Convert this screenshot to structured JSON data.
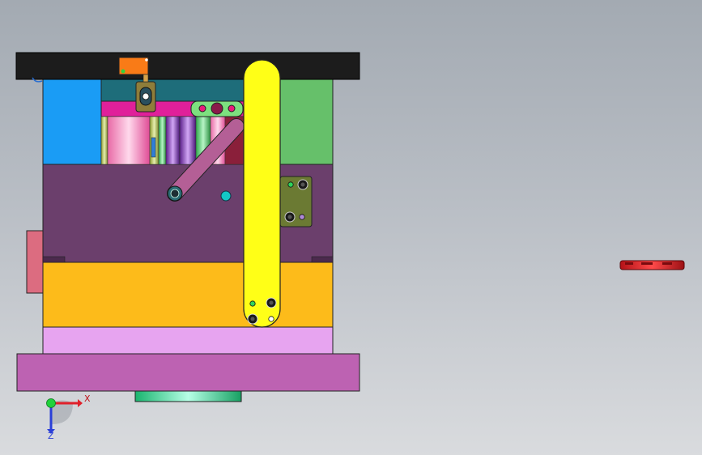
{
  "viewport": {
    "background_top": "#a3aab2",
    "background_bottom": "#d9dbde"
  },
  "triad": {
    "x_label": "X",
    "z_label": "Z",
    "x_color": "#e0202a",
    "y_color": "#1fd23a",
    "z_color": "#2a3fd8"
  },
  "colors": {
    "top_clamp_plate": "#1c1c1c",
    "left_cavity_insert": "#1a9cf5",
    "right_cavity_insert": "#66c06a",
    "mid_plate": "#6b3f6c",
    "support_plate": "#fdbb1a",
    "spacer_plate": "#e7a4f0",
    "bottom_clamp_plate": "#bd62b2",
    "locating_ring": "#40e6a6",
    "lifter_arm": "#ffff17",
    "angled_link": "#b45f96",
    "side_block": "#dc6c80",
    "remote_part": "#e0262a",
    "tag_block": "#f97b17"
  },
  "icons": [
    "triad-icon"
  ]
}
